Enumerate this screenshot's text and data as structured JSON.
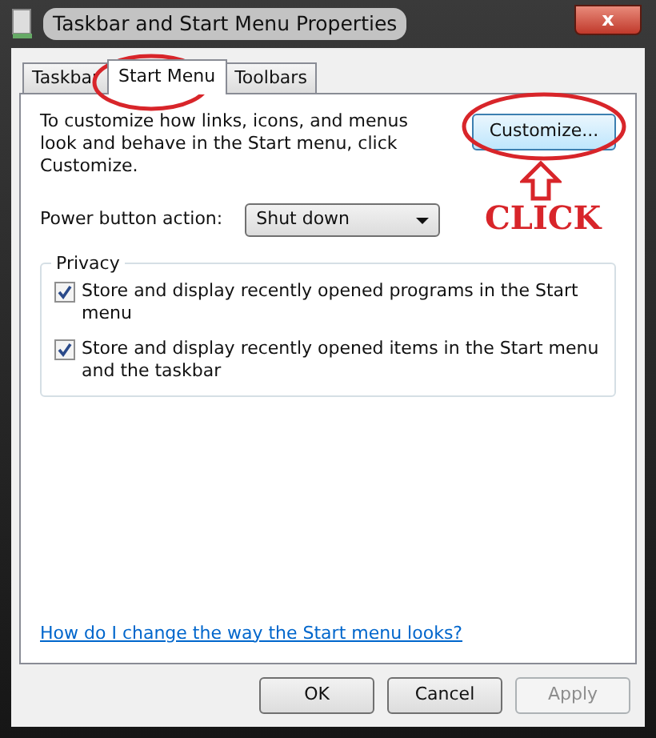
{
  "window": {
    "title": "Taskbar and Start Menu Properties",
    "close": "x"
  },
  "tabs": [
    {
      "label": "Taskbar",
      "selected": false
    },
    {
      "label": "Start Menu",
      "selected": true
    },
    {
      "label": "Toolbars",
      "selected": false
    }
  ],
  "intro": "To customize how links, icons, and menus look and behave in the Start menu, click Customize.",
  "customize_button": "Customize...",
  "power_action": {
    "label": "Power button action:",
    "value": "Shut down"
  },
  "privacy": {
    "title": "Privacy",
    "options": [
      {
        "label": "Store and display recently opened programs in the Start menu",
        "checked": true
      },
      {
        "label": "Store and display recently opened items in the Start menu and the taskbar",
        "checked": true
      }
    ]
  },
  "help_link": "How do I change the way the Start menu looks?",
  "buttons": [
    {
      "label": "OK",
      "disabled": false
    },
    {
      "label": "Cancel",
      "disabled": false
    },
    {
      "label": "Apply",
      "disabled": true
    }
  ],
  "annotation": {
    "text": "CLICK"
  }
}
